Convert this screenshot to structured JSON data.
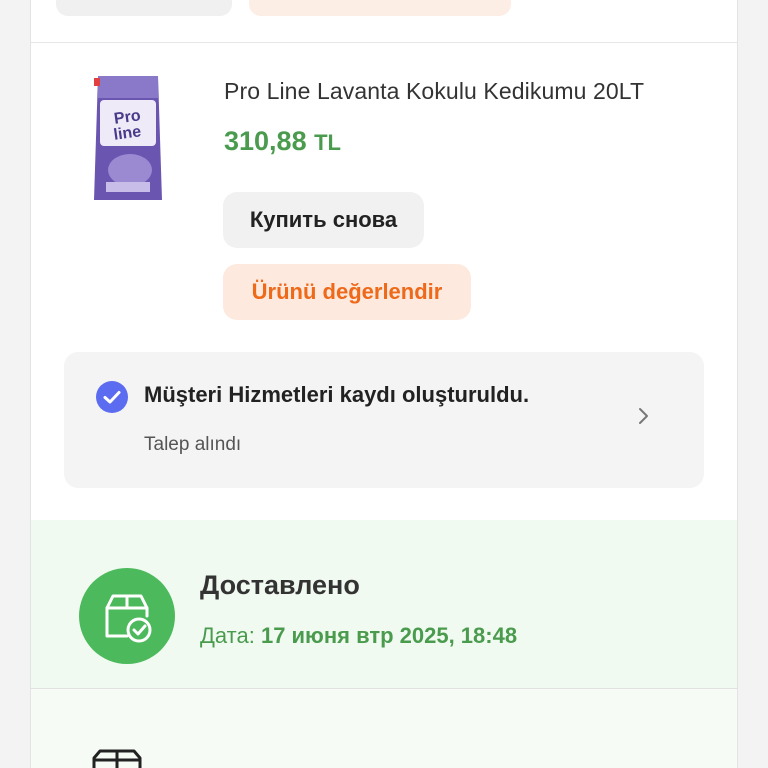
{
  "product": {
    "title": "Pro Line Lavanta Kokulu Kedikumu 20LT",
    "price": "310,88",
    "currency": "TL",
    "image_brand_text": "Pro line",
    "buy_again_label": "Купить снова",
    "rate_label": "Ürünü değerlendir"
  },
  "customer_service": {
    "title": "Müşteri Hizmetleri kaydı oluşturuldu.",
    "subtitle": "Talep alındı"
  },
  "delivery": {
    "status": "Доставлено",
    "date_label": "Дата:",
    "date_value": "17 июня втр 2025, 18:48"
  },
  "colors": {
    "price_green": "#4a9b4e",
    "delivered_circle": "#4cba5c",
    "rate_orange": "#ee6a1a",
    "check_blue": "#5b6cf0"
  },
  "icons": {
    "check": "check-circle-icon",
    "chevron": "chevron-right-icon",
    "delivered": "package-check-icon",
    "truck": "truck-icon"
  }
}
